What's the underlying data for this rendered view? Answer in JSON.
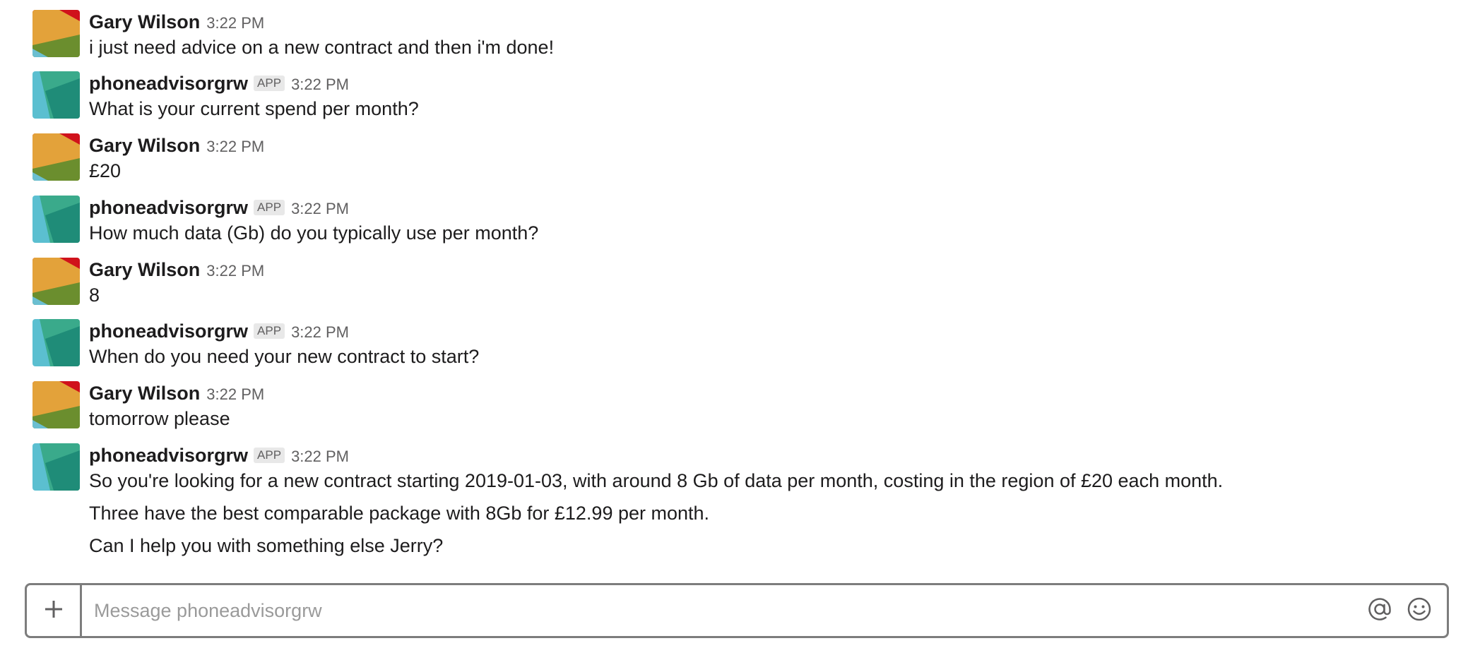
{
  "messages": [
    {
      "sender": "Gary Wilson",
      "time": "3:22 PM",
      "is_app": false,
      "lines": [
        "i just need advice on a new contract and then i'm done!"
      ]
    },
    {
      "sender": "phoneadvisorgrw",
      "badge": "APP",
      "time": "3:22 PM",
      "is_app": true,
      "lines": [
        "What is your current spend per month?"
      ]
    },
    {
      "sender": "Gary Wilson",
      "time": "3:22 PM",
      "is_app": false,
      "lines": [
        "£20"
      ]
    },
    {
      "sender": "phoneadvisorgrw",
      "badge": "APP",
      "time": "3:22 PM",
      "is_app": true,
      "lines": [
        "How much data (Gb) do you typically use per month?"
      ]
    },
    {
      "sender": "Gary Wilson",
      "time": "3:22 PM",
      "is_app": false,
      "lines": [
        "8"
      ]
    },
    {
      "sender": "phoneadvisorgrw",
      "badge": "APP",
      "time": "3:22 PM",
      "is_app": true,
      "lines": [
        "When do you need your new contract to start?"
      ]
    },
    {
      "sender": "Gary Wilson",
      "time": "3:22 PM",
      "is_app": false,
      "lines": [
        "tomorrow please"
      ]
    },
    {
      "sender": "phoneadvisorgrw",
      "badge": "APP",
      "time": "3:22 PM",
      "is_app": true,
      "lines": [
        "So you're looking for a new contract starting 2019-01-03, with around 8 Gb of data per month, costing in the region of £20 each month.",
        "Three have the best comparable package with 8Gb for £12.99 per month.",
        "Can I help you with something else Jerry?"
      ]
    }
  ],
  "composer": {
    "placeholder": "Message phoneadvisorgrw",
    "value": "",
    "icons": [
      "plus-icon",
      "at-icon",
      "emoji-icon"
    ]
  },
  "colors": {
    "user_avatar": [
      "#d0121b",
      "#e3a23a",
      "#6b8e2e",
      "#6bbfd1"
    ],
    "app_avatar": [
      "#5bbfd0",
      "#3aaa8b",
      "#1f8c78"
    ],
    "composer_border": "#7d7d7d",
    "timestamp": "#616061"
  }
}
